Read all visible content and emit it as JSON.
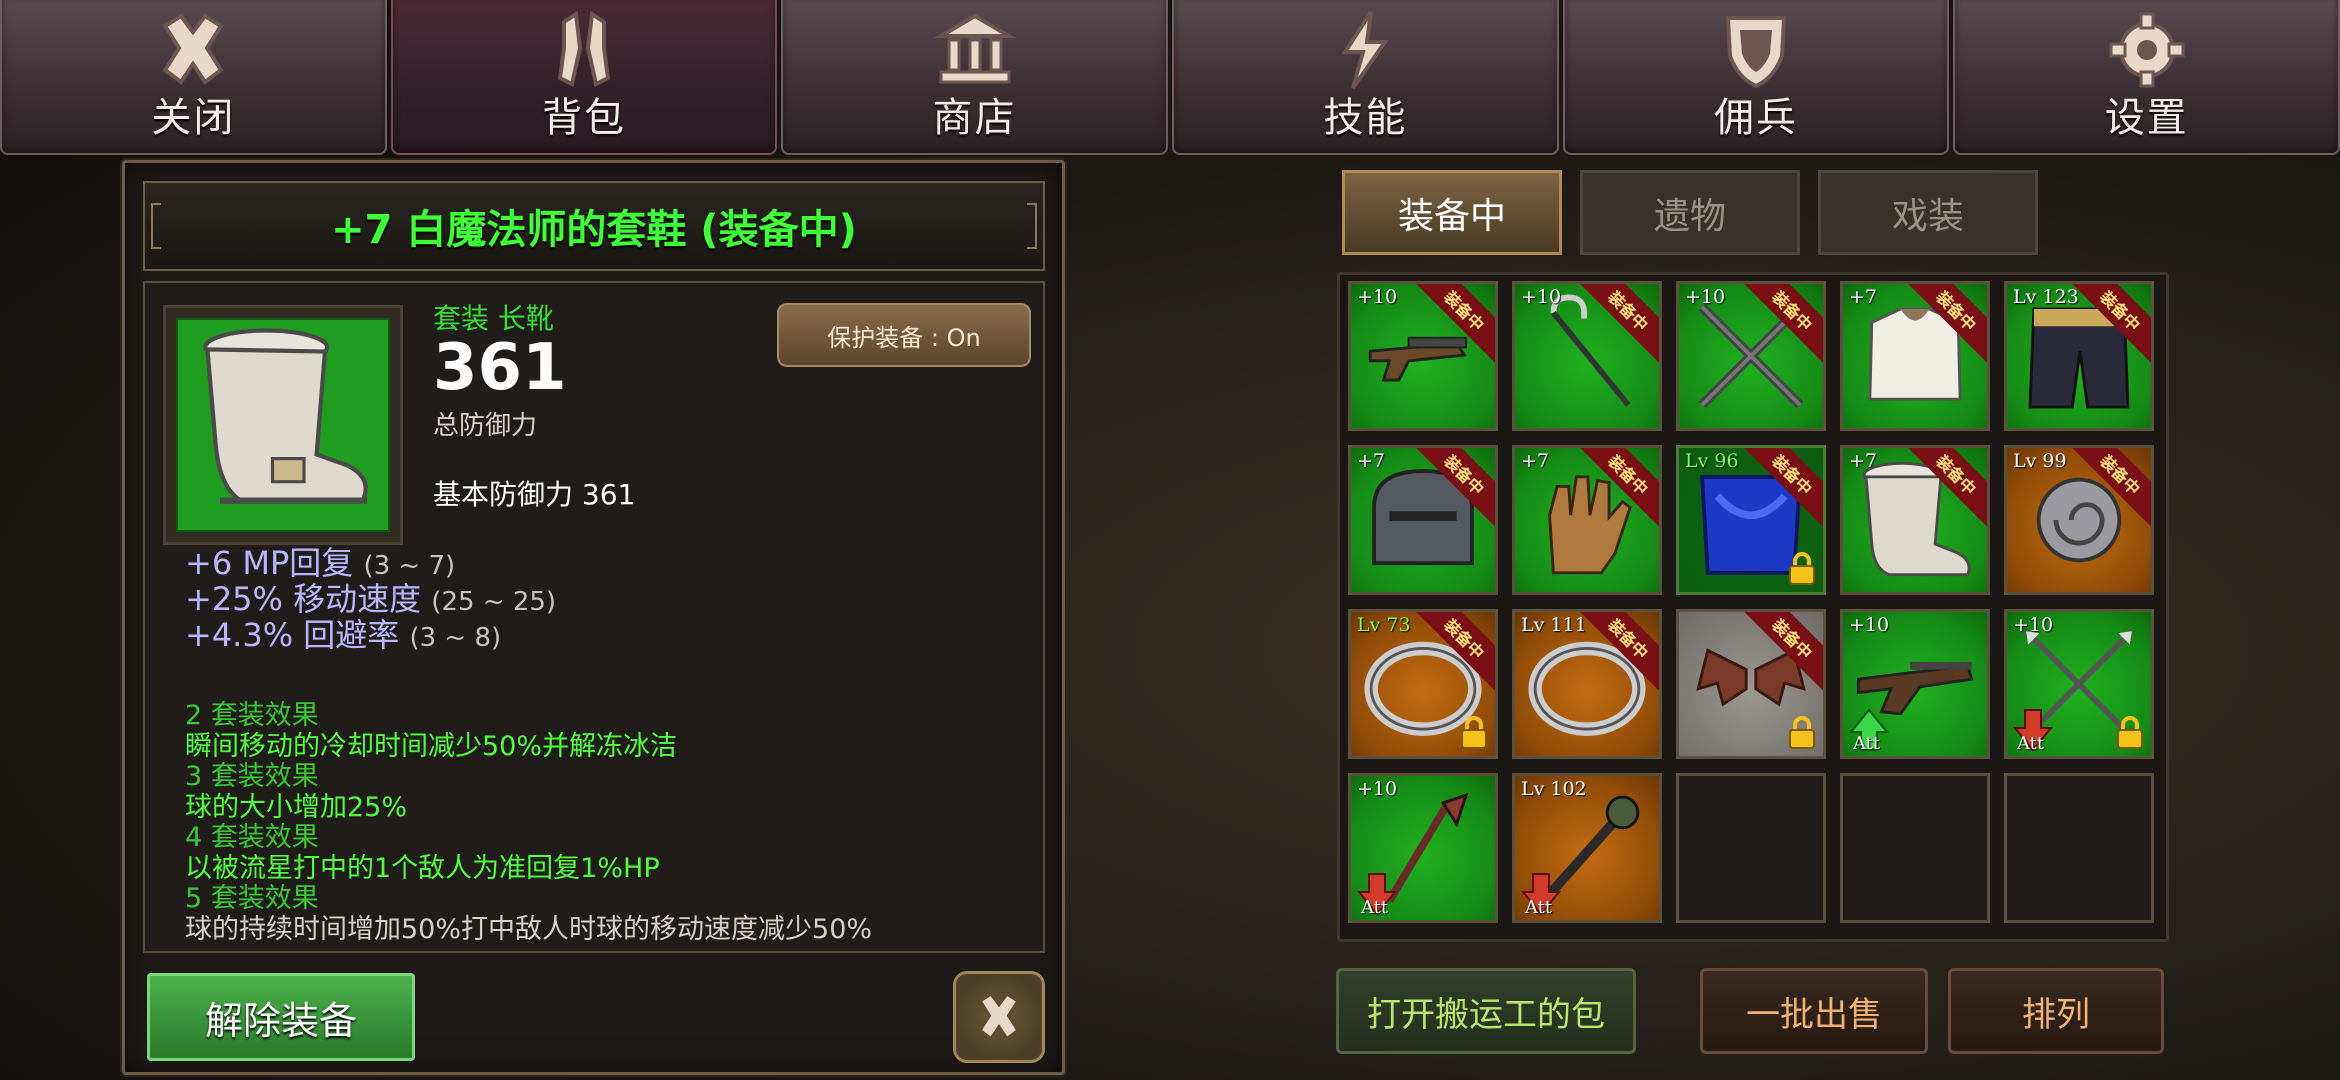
{
  "topnav": {
    "items": [
      {
        "label": "关闭",
        "icon": "close-x-icon"
      },
      {
        "label": "背包",
        "icon": "backpack-icon",
        "active": true
      },
      {
        "label": "商店",
        "icon": "shop-building-icon"
      },
      {
        "label": "技能",
        "icon": "lightning-icon"
      },
      {
        "label": "佣兵",
        "icon": "shield-icon"
      },
      {
        "label": "设置",
        "icon": "gear-icon"
      }
    ]
  },
  "detail": {
    "title": "+7 白魔法师的套鞋 (装备中)",
    "set_label": "套装 长靴",
    "defense": "361",
    "defense_caption": "总防御力",
    "base_defense": "基本防御力 361",
    "protect_button": "保护装备 : On",
    "stats": [
      {
        "text": "+6 MP回复",
        "range": "(3 ~ 7)"
      },
      {
        "text": "+25% 移动速度",
        "range": "(25 ~ 25)"
      },
      {
        "text": "+4.3% 回避率",
        "range": "(3 ~ 8)"
      }
    ],
    "set_effects": [
      {
        "head": "2 套装效果",
        "desc": "瞬间移动的冷却时间减少50%并解冻冰洁"
      },
      {
        "head": "3 套装效果",
        "desc": "球的大小增加25%"
      },
      {
        "head": "4 套装效果",
        "desc": "以被流星打中的1个敌人为准回复1%HP"
      },
      {
        "head": "5 套装效果",
        "desc": "球的持续时间增加50%打中敌人时球的移动速度减少50%"
      }
    ],
    "unequip_button": "解除装备",
    "accent_color": "#3cff35"
  },
  "inventory": {
    "tabs": [
      "装备中",
      "遗物",
      "戏装"
    ],
    "equipped_ribbon": "装备中",
    "slots": [
      {
        "level": "+10",
        "color": "green",
        "equipped": true,
        "item": "pistol"
      },
      {
        "level": "+10",
        "color": "green",
        "equipped": true,
        "item": "cane"
      },
      {
        "level": "+10",
        "color": "green",
        "equipped": true,
        "item": "crossed-swords"
      },
      {
        "level": "+7",
        "color": "green",
        "equipped": true,
        "item": "white-armor"
      },
      {
        "level": "Lv 123",
        "color": "green",
        "equipped": true,
        "item": "pants"
      },
      {
        "level": "+7",
        "color": "green",
        "equipped": true,
        "item": "helmet"
      },
      {
        "level": "+7",
        "color": "green",
        "equipped": true,
        "item": "gloves"
      },
      {
        "level": "Lv 96",
        "color": "blue",
        "equipped": true,
        "locked": true,
        "item": "blue-cape"
      },
      {
        "level": "+7",
        "color": "green",
        "equipped": true,
        "item": "boots"
      },
      {
        "level": "Lv 99",
        "color": "orange",
        "equipped": true,
        "item": "shell-amulet"
      },
      {
        "level": "Lv 73",
        "color": "orange",
        "equipped": true,
        "locked": true,
        "item": "ring"
      },
      {
        "level": "Lv 111",
        "color": "orange",
        "equipped": true,
        "item": "ring"
      },
      {
        "level": "",
        "color": "grey",
        "equipped": true,
        "locked": true,
        "item": "bat-wings"
      },
      {
        "level": "+10",
        "color": "green",
        "equipped": false,
        "att": "up",
        "att_label": "Att",
        "item": "rifle"
      },
      {
        "level": "+10",
        "color": "green",
        "equipped": false,
        "att": "down",
        "att_label": "Att",
        "locked": true,
        "item": "crossed-spears"
      },
      {
        "level": "+10",
        "color": "green",
        "equipped": false,
        "att": "down",
        "att_label": "Att",
        "item": "axe"
      },
      {
        "level": "Lv 102",
        "color": "orange",
        "equipped": false,
        "att": "down",
        "att_label": "Att",
        "item": "mace"
      },
      {
        "color": "empty"
      },
      {
        "color": "empty"
      },
      {
        "color": "empty"
      }
    ],
    "buttons": {
      "porter": "打开搬运工的包",
      "sell": "一批出售",
      "sort": "排列"
    }
  }
}
